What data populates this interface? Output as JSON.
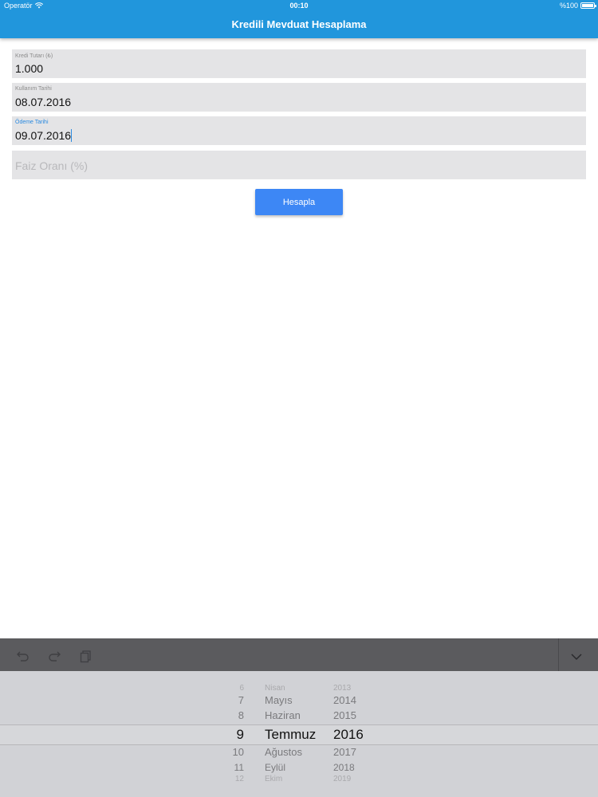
{
  "status_bar": {
    "carrier": "Operatör",
    "time": "00:10",
    "battery": "%100"
  },
  "header": {
    "title": "Kredili Mevduat Hesaplama",
    "background": "#2196dc"
  },
  "form": {
    "amount": {
      "label": "Kredi Tutarı (₺)",
      "value": "1.000"
    },
    "usage_date": {
      "label": "Kullanım Tarihi",
      "value": "08.07.2016"
    },
    "payment_date": {
      "label": "Ödeme Tarihi",
      "value": "09.07.2016"
    },
    "interest_rate": {
      "placeholder": "Faiz Oranı (%)"
    },
    "calculate_label": "Hesapla"
  },
  "keyboard_toolbar": {
    "icons": [
      "undo-icon",
      "redo-icon",
      "paste-icon",
      "chevron-down-icon"
    ]
  },
  "picker": {
    "days": [
      "6",
      "7",
      "8",
      "9",
      "10",
      "11",
      "12"
    ],
    "months": [
      "Nisan",
      "Mayıs",
      "Haziran",
      "Temmuz",
      "Ağustos",
      "Eylül",
      "Ekim"
    ],
    "years": [
      "2013",
      "2014",
      "2015",
      "2016",
      "2017",
      "2018",
      "2019"
    ],
    "selected": {
      "day": "9",
      "month": "Temmuz",
      "year": "2016"
    }
  }
}
